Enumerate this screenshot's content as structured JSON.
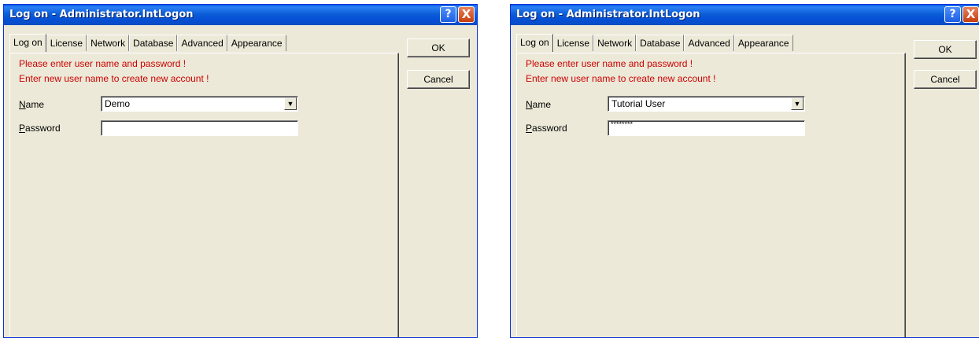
{
  "dialogs": [
    {
      "title": "Log on - Administrator.IntLogon",
      "help_glyph": "?",
      "close_glyph": "X",
      "tabs": [
        "Log on",
        "License",
        "Network",
        "Database",
        "Advanced",
        "Appearance"
      ],
      "active_tab": "Log on",
      "message_line1": "Please enter user name and password !",
      "message_line2": "Enter new user name to create new account !",
      "name_label_accel": "N",
      "name_label_rest": "ame",
      "password_label_accel": "P",
      "password_label_rest": "assword",
      "name_value": "Demo",
      "password_value": "",
      "dropdown_glyph": "▼",
      "ok_label": "OK",
      "cancel_label": "Cancel"
    },
    {
      "title": "Log on - Administrator.IntLogon",
      "help_glyph": "?",
      "close_glyph": "X",
      "tabs": [
        "Log on",
        "License",
        "Network",
        "Database",
        "Advanced",
        "Appearance"
      ],
      "active_tab": "Log on",
      "message_line1": "Please enter user name and password !",
      "message_line2": "Enter new user name to create new account !",
      "name_label_accel": "N",
      "name_label_rest": "ame",
      "password_label_accel": "P",
      "password_label_rest": "assword",
      "name_value": "Tutorial User",
      "password_value": "********",
      "dropdown_glyph": "▼",
      "ok_label": "OK",
      "cancel_label": "Cancel"
    }
  ],
  "colors": {
    "title_bar": "#0a5fe8",
    "dialog_face": "#ece9d8",
    "message_text": "#cc0000",
    "close_button": "#c63e10"
  }
}
